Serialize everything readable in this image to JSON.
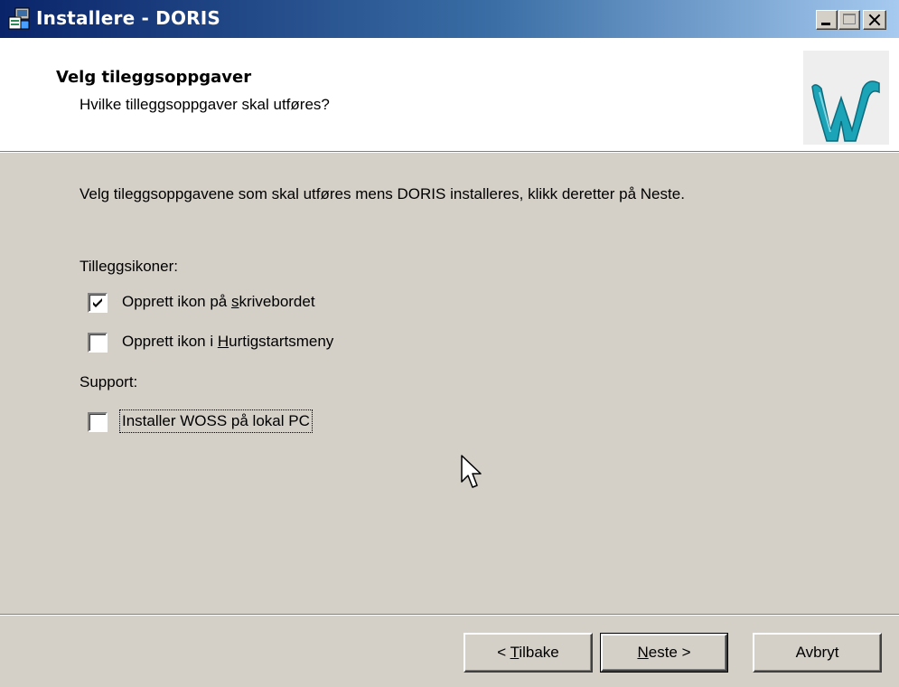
{
  "window": {
    "title": "Installere - DORIS"
  },
  "header": {
    "title": "Velg tileggsoppgaver",
    "subtitle": "Hvilke tilleggsoppgaver skal utføres?"
  },
  "content": {
    "intro": "Velg tileggsoppgavene som skal utføres mens DORIS installeres, klikk deretter på Neste.",
    "groups": [
      {
        "label": "Tilleggsikoner:",
        "options": [
          {
            "label_before": "Opprett ikon på ",
            "accel": "s",
            "label_after": "krivebordet",
            "checked": true
          },
          {
            "label_before": "Opprett ikon i ",
            "accel": "H",
            "label_after": "urtigstartsmeny",
            "checked": false
          }
        ]
      },
      {
        "label": "Support:",
        "options": [
          {
            "label": "Installer WOSS på lokal PC",
            "checked": false,
            "focused": true
          }
        ]
      }
    ]
  },
  "buttons": {
    "back": {
      "before": "< ",
      "accel": "T",
      "after": "ilbake"
    },
    "next": {
      "accel": "N",
      "after": "este >"
    },
    "cancel": {
      "label": "Avbryt"
    }
  },
  "colors": {
    "titlebar_start": "#0a246a",
    "titlebar_end": "#a6caf0",
    "face": "#d4d0c8",
    "logo_teal": "#1ba3b8"
  },
  "icons": {
    "title": "installer-icon",
    "logo": "w-logo-icon",
    "cursor": "mouse-pointer-icon"
  }
}
